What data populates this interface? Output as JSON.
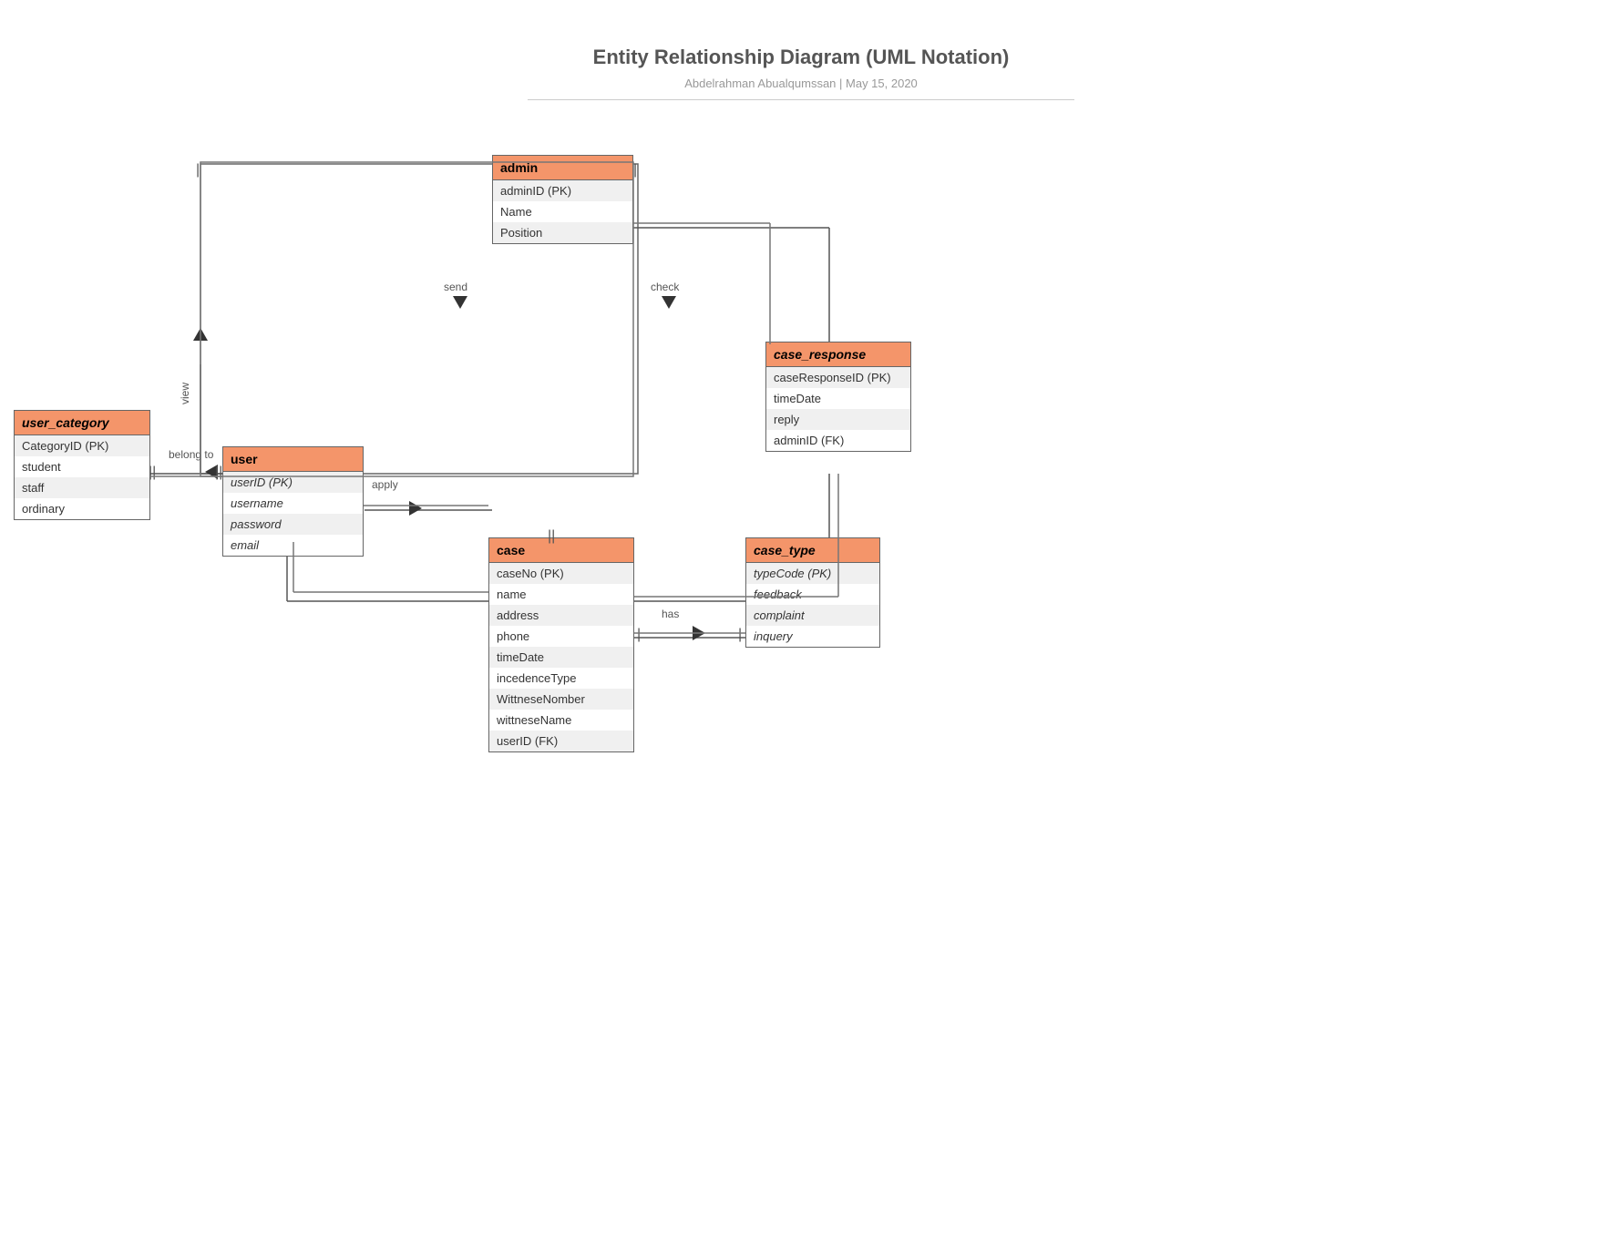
{
  "header": {
    "title": "Entity Relationship Diagram (UML Notation)",
    "subtitle": "Abdelrahman Abualqumssan  |  May 15, 2020"
  },
  "entities": {
    "admin": {
      "name": "admin",
      "italic": false,
      "fields": [
        "adminID  (PK)",
        "Name",
        "Position"
      ]
    },
    "case_response": {
      "name": "case_response",
      "italic": true,
      "fields": [
        "caseResponseID  (PK)",
        "timeDate",
        "reply",
        "adminID (FK)"
      ]
    },
    "user_category": {
      "name": "user_category",
      "italic": true,
      "fields": [
        "CategoryID (PK)",
        "student",
        "staff",
        "ordinary"
      ]
    },
    "user": {
      "name": "user",
      "italic": false,
      "fields": [
        "userID (PK)",
        "username",
        "password",
        "email"
      ]
    },
    "case": {
      "name": "case",
      "italic": false,
      "fields": [
        "caseNo  (PK)",
        "name",
        "address",
        "phone",
        "timeDate",
        "incedenceType",
        "WittneseNomber",
        "wittneseName",
        "userID (FK)"
      ]
    },
    "case_type": {
      "name": "case_type",
      "italic": true,
      "fields": [
        "typeCode (PK)",
        "feedback",
        "complaint",
        "inquery"
      ]
    }
  },
  "relationships": {
    "send": "send",
    "check": "check",
    "view": "view",
    "belong_to": "belong to",
    "apply": "apply",
    "has": "has"
  }
}
